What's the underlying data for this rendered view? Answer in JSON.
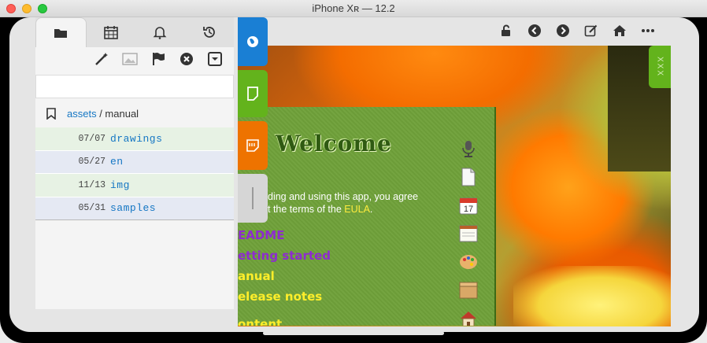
{
  "window": {
    "title": "iPhone Xʀ — 12.2"
  },
  "left_panel": {
    "tabs": [
      {
        "icon": "folder-icon",
        "active": true
      },
      {
        "icon": "calendar-icon",
        "active": false
      },
      {
        "icon": "bell-icon",
        "active": false
      },
      {
        "icon": "history-icon",
        "active": false
      }
    ],
    "actions": [
      "magic-wand-icon",
      "image-icon",
      "flag-icon",
      "close-circle-icon",
      "dropdown-box-icon"
    ],
    "search": {
      "value": "",
      "placeholder": ""
    },
    "breadcrumb": {
      "root": "assets",
      "separator": " / ",
      "current": "manual"
    },
    "rows": [
      {
        "date": "07/07",
        "name": "drawings"
      },
      {
        "date": "05/27",
        "name": "en"
      },
      {
        "date": "11/13",
        "name": "img"
      },
      {
        "date": "05/31",
        "name": "samples"
      }
    ]
  },
  "side_tabs": [
    "globe-icon",
    "note-icon",
    "sticky-note-icon",
    "handle"
  ],
  "right_tab": {
    "label": "XXX"
  },
  "toolbar": [
    "unlock-icon",
    "back-icon",
    "forward-icon",
    "edit-icon",
    "home-icon",
    "more-icon"
  ],
  "welcome": {
    "title": "Welcome",
    "text_line1": "ding and using this app, you agree",
    "text_line2_prefix": "t the terms of the ",
    "text_eula": "EULA",
    "text_suffix": ".",
    "menu": [
      {
        "label": "EADME",
        "color": "#8e2bd0"
      },
      {
        "label": "etting started",
        "color": "#8e2bd0"
      },
      {
        "label": "anual",
        "color": "#ffee2a"
      },
      {
        "label": "elease notes",
        "color": "#ffee2a"
      },
      {
        "label": "ontent",
        "color": "#ffee2a"
      }
    ],
    "icons": [
      "microphone-icon",
      "document-icon",
      "calendar-17-icon",
      "notepad-icon",
      "palette-icon",
      "box-icon",
      "house-icon"
    ],
    "calendar_day": "17"
  },
  "colors": {
    "blue_tab": "#1a7fd4",
    "green_tab": "#63b31c",
    "orange_tab": "#ee7300",
    "link": "#1677c4"
  }
}
